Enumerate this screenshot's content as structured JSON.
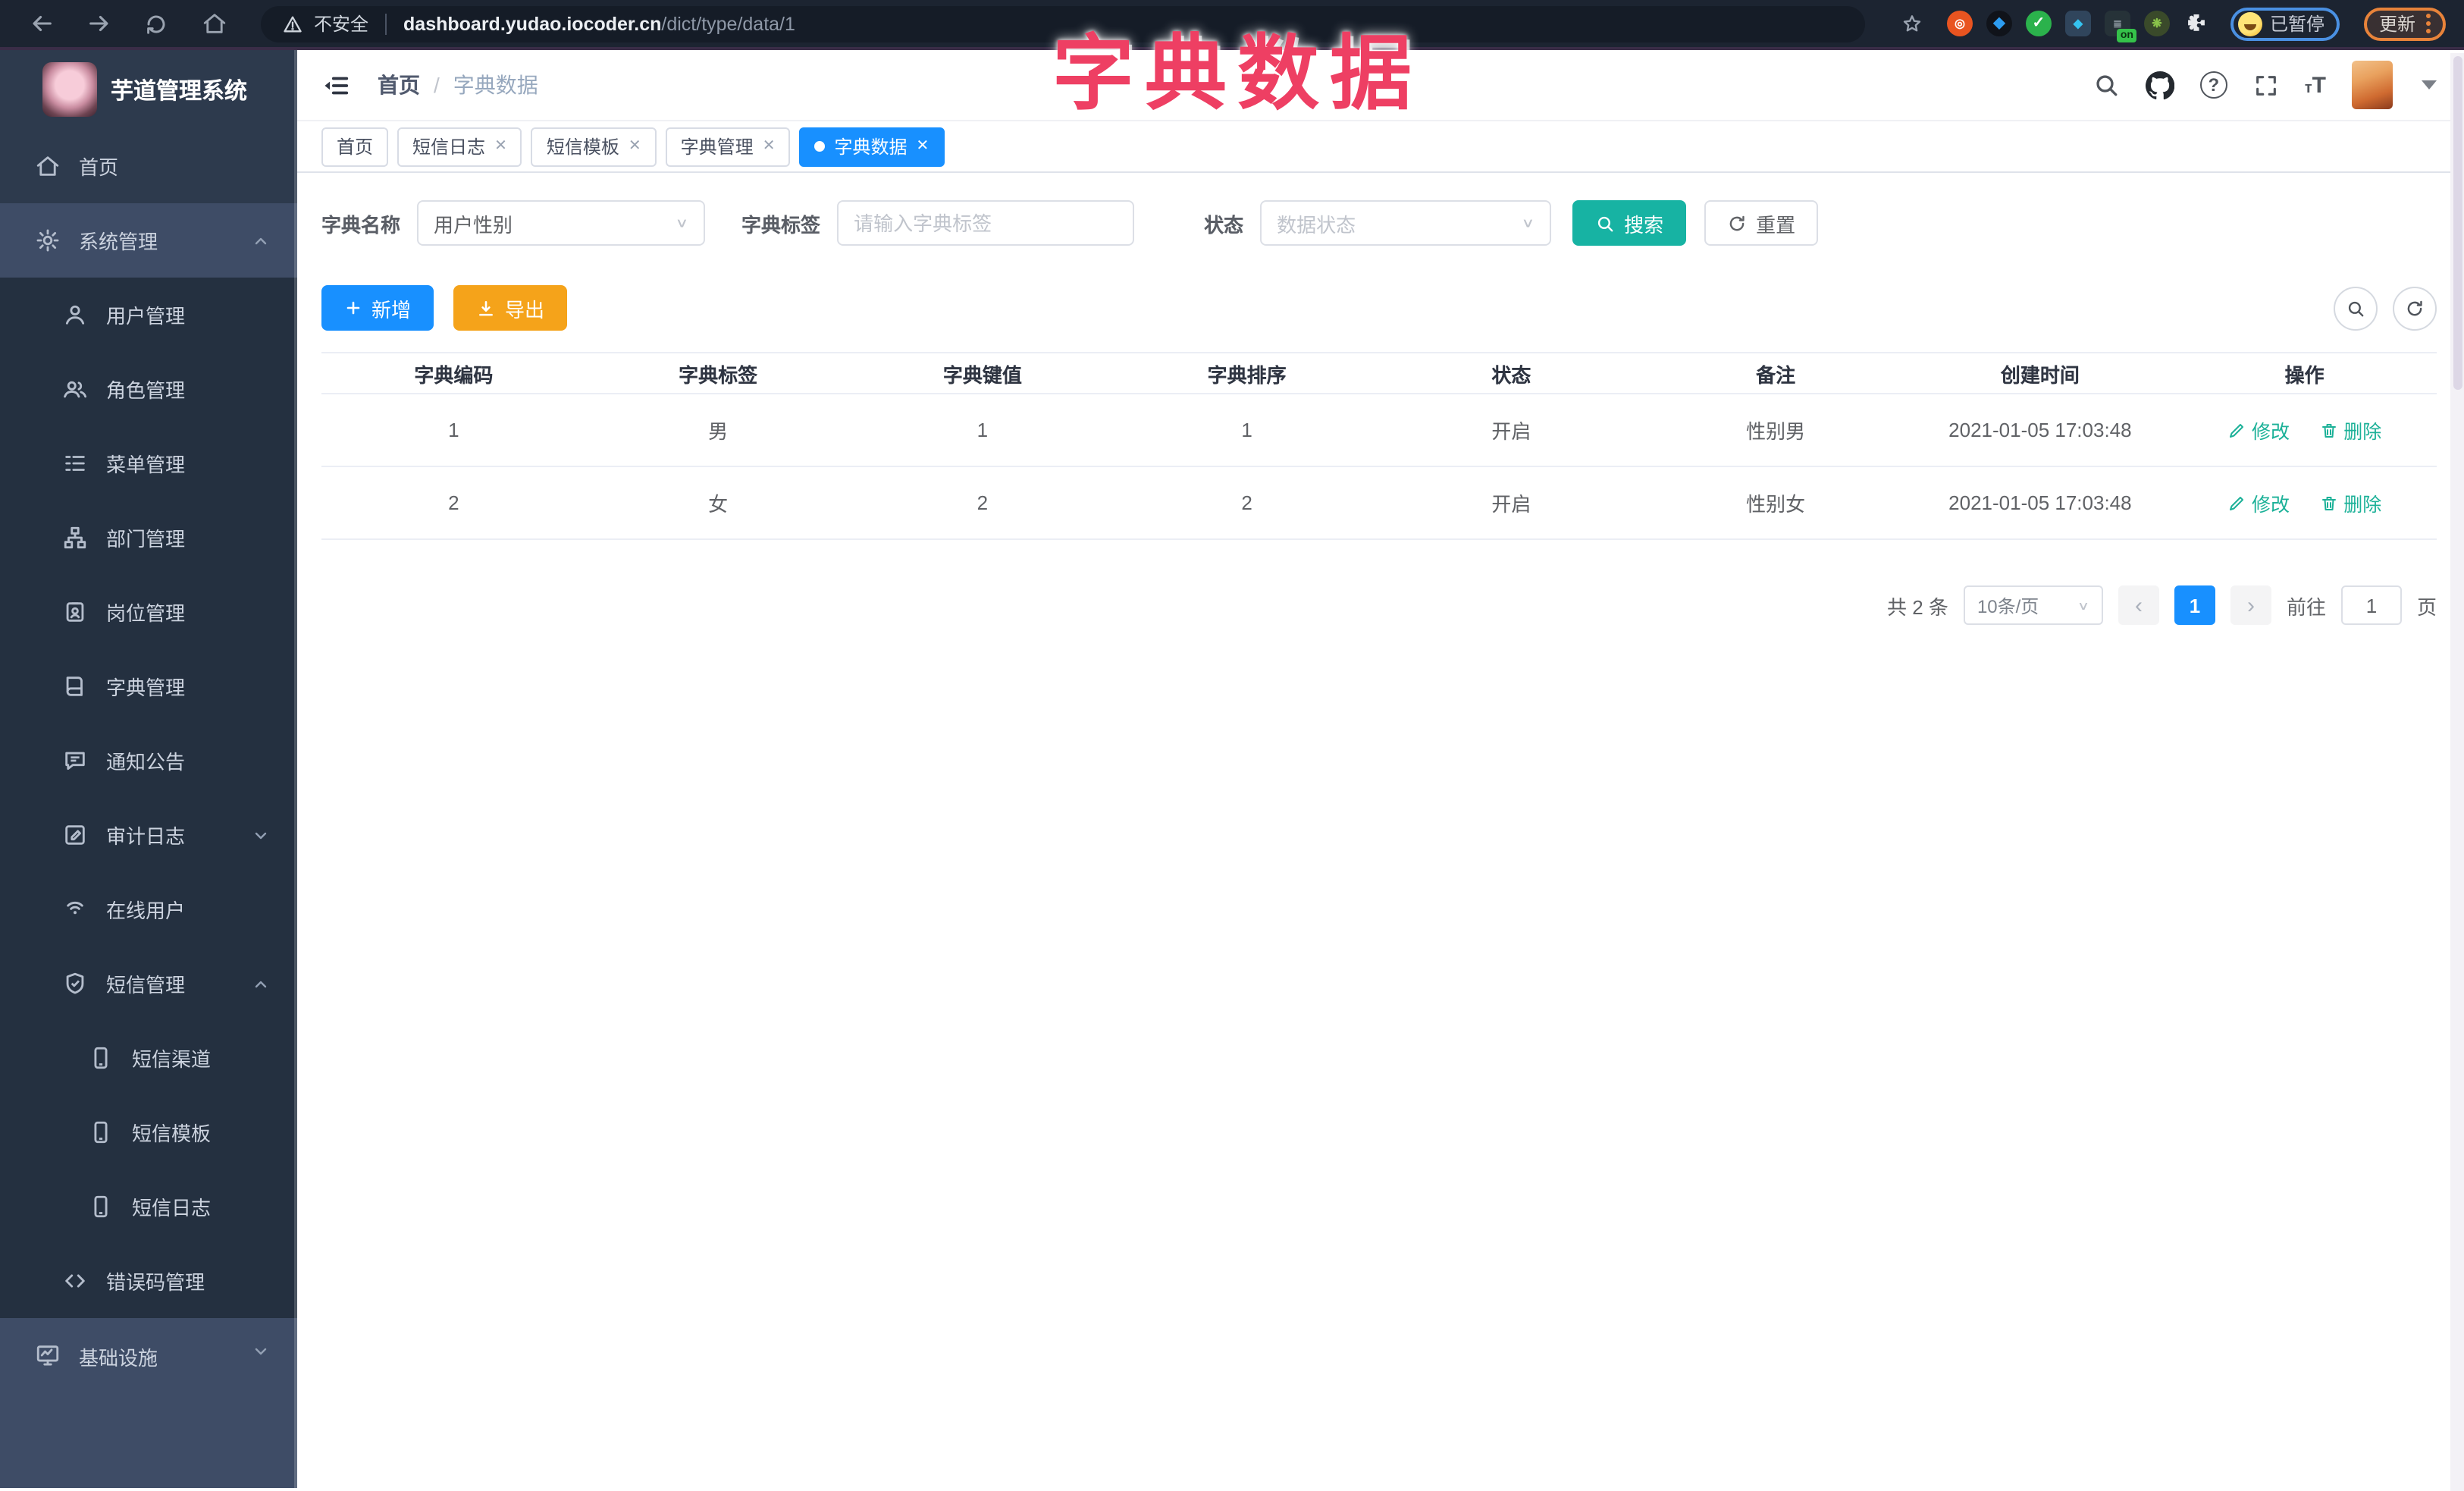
{
  "browser": {
    "security_label": "不安全",
    "url_host": "dashboard.yudao.iocoder.cn",
    "url_path": "/dict/type/data/1",
    "extensions": [
      {
        "name": "orange-ring-extension",
        "color": "#e95420"
      },
      {
        "name": "blue-gem-extension",
        "color": "#2d9cf0"
      },
      {
        "name": "green-check-extension",
        "color": "#2bb24c"
      },
      {
        "name": "blue-diamond-extension",
        "color": "#30455c"
      },
      {
        "name": "on-badge-extension",
        "color": "#263238",
        "badge": "on"
      },
      {
        "name": "green-dot-extension",
        "color": "#7cb342"
      },
      {
        "name": "puzzle-extension",
        "color": "#e8eaed"
      }
    ],
    "profile_chip_label": "已暂停",
    "update_label": "更新"
  },
  "annotation": {
    "text": "字典数据",
    "color": "#ee3f63"
  },
  "sidebar": {
    "app_title": "芋道管理系统",
    "items": [
      {
        "label": "首页",
        "icon": "home-icon",
        "level": 1
      },
      {
        "label": "系统管理",
        "icon": "gear-icon",
        "level": 1,
        "chevron": "up",
        "highlighted": true
      },
      {
        "label": "用户管理",
        "icon": "user-icon",
        "level": 2
      },
      {
        "label": "角色管理",
        "icon": "users-icon",
        "level": 2
      },
      {
        "label": "菜单管理",
        "icon": "menu-list-icon",
        "level": 2
      },
      {
        "label": "部门管理",
        "icon": "org-tree-icon",
        "level": 2
      },
      {
        "label": "岗位管理",
        "icon": "id-badge-icon",
        "level": 2
      },
      {
        "label": "字典管理",
        "icon": "dictionary-icon",
        "level": 2
      },
      {
        "label": "通知公告",
        "icon": "announcement-icon",
        "level": 2
      },
      {
        "label": "审计日志",
        "icon": "audit-log-icon",
        "level": 2,
        "chevron": "down"
      },
      {
        "label": "在线用户",
        "icon": "online-users-icon",
        "level": 2
      },
      {
        "label": "短信管理",
        "icon": "shield-check-icon",
        "level": 2,
        "chevron": "up"
      },
      {
        "label": "短信渠道",
        "icon": "phone-icon",
        "level": 3
      },
      {
        "label": "短信模板",
        "icon": "phone-icon",
        "level": 3
      },
      {
        "label": "短信日志",
        "icon": "phone-icon",
        "level": 3
      },
      {
        "label": "错误码管理",
        "icon": "code-icon",
        "level": 2
      },
      {
        "label": "基础设施",
        "icon": "monitor-icon",
        "level": 1,
        "chevron": "down",
        "highlighted": true
      }
    ]
  },
  "navbar": {
    "breadcrumb": {
      "root": "首页",
      "separator": "/",
      "current": "字典数据"
    },
    "icons": [
      "search-icon",
      "github-icon",
      "help-icon",
      "fullscreen-icon",
      "font-size-icon",
      "avatar",
      "caret-down-icon"
    ]
  },
  "tabs": [
    {
      "label": "首页",
      "closable": false,
      "active": false
    },
    {
      "label": "短信日志",
      "closable": true,
      "active": false
    },
    {
      "label": "短信模板",
      "closable": true,
      "active": false
    },
    {
      "label": "字典管理",
      "closable": true,
      "active": false
    },
    {
      "label": "字典数据",
      "closable": true,
      "active": true
    }
  ],
  "filters": {
    "dict_name_label": "字典名称",
    "dict_name_value": "用户性别",
    "dict_label_label": "字典标签",
    "dict_label_placeholder": "请输入字典标签",
    "status_label": "状态",
    "status_placeholder": "数据状态",
    "search_label": "搜索",
    "reset_label": "重置"
  },
  "toolbar": {
    "add_label": "新增",
    "export_label": "导出"
  },
  "table": {
    "columns": [
      "字典编码",
      "字典标签",
      "字典键值",
      "字典排序",
      "状态",
      "备注",
      "创建时间",
      "操作"
    ],
    "rows": [
      [
        "1",
        "男",
        "1",
        "1",
        "开启",
        "性别男",
        "2021-01-05 17:03:48"
      ],
      [
        "2",
        "女",
        "2",
        "2",
        "开启",
        "性别女",
        "2021-01-05 17:03:48"
      ]
    ],
    "edit_label": "修改",
    "delete_label": "删除"
  },
  "pagination": {
    "total_text": "共 2 条",
    "page_size_value": "10条/页",
    "page": "1",
    "goto_label": "前往",
    "goto_value": "1",
    "goto_suffix": "页"
  },
  "colors": {
    "primary_blue": "#1890ff",
    "action_teal": "#17b3a3",
    "export_orange": "#f5a31a",
    "annotation_red": "#ee3f63",
    "sidebar_bg": "#2d3a4d",
    "submenu_bg": "#243040",
    "sidebar_highlight_bg": "#3e4c66"
  }
}
